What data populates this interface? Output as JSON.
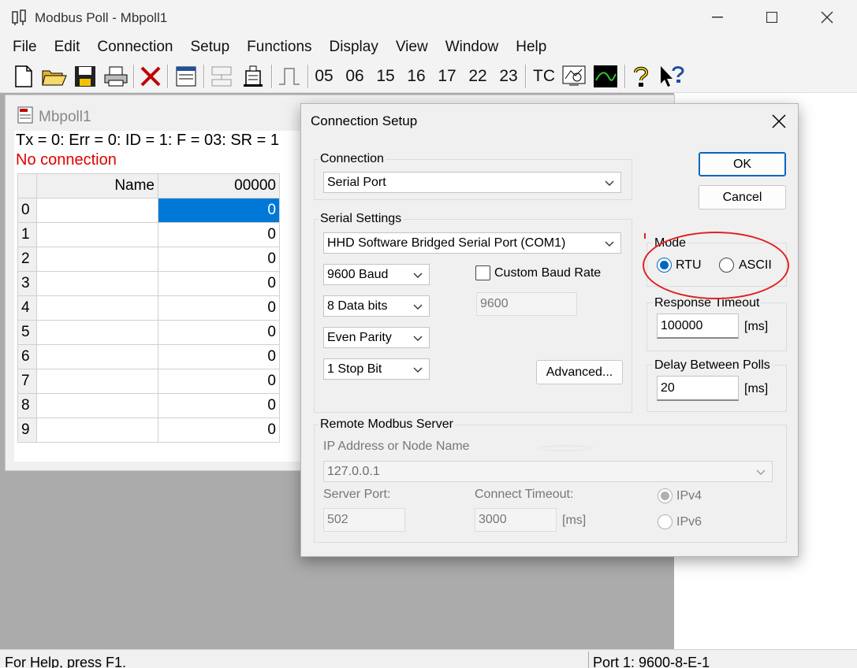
{
  "app": {
    "title": "Modbus Poll - Mbpoll1"
  },
  "window_controls": {
    "minimize": "—",
    "maximize": "☐",
    "close": "✕"
  },
  "menu": [
    "File",
    "Edit",
    "Connection",
    "Setup",
    "Functions",
    "Display",
    "View",
    "Window",
    "Help"
  ],
  "toolbar": {
    "function_codes": [
      "05",
      "06",
      "15",
      "16",
      "17",
      "22",
      "23"
    ],
    "tc": "TC"
  },
  "child": {
    "title": "Mbpoll1",
    "status_line": "Tx = 0: Err = 0: ID = 1: F = 03: SR = 1",
    "no_connection": "No connection",
    "header_name": "Name",
    "header_col": "00000",
    "rows": [
      {
        "n": "0",
        "v": "0"
      },
      {
        "n": "1",
        "v": "0"
      },
      {
        "n": "2",
        "v": "0"
      },
      {
        "n": "3",
        "v": "0"
      },
      {
        "n": "4",
        "v": "0"
      },
      {
        "n": "5",
        "v": "0"
      },
      {
        "n": "6",
        "v": "0"
      },
      {
        "n": "7",
        "v": "0"
      },
      {
        "n": "8",
        "v": "0"
      },
      {
        "n": "9",
        "v": "0"
      }
    ]
  },
  "dialog": {
    "title": "Connection Setup",
    "close": "✕",
    "connection_group": "Connection",
    "connection_value": "Serial Port",
    "serial_group": "Serial Settings",
    "port_value": "HHD Software Bridged Serial Port (COM1)",
    "baud_value": "9600 Baud",
    "databits_value": "8 Data bits",
    "parity_value": "Even Parity",
    "stopbit_value": "1 Stop Bit",
    "custom_baud_label": "Custom Baud Rate",
    "custom_baud_value": "9600",
    "advanced_button": "Advanced...",
    "ok_button": "OK",
    "cancel_button": "Cancel",
    "mode_group": "Mode",
    "mode_rtu": "RTU",
    "mode_ascii": "ASCII",
    "response_timeout_group": "Response Timeout",
    "response_timeout_value": "100000",
    "ms_unit": "[ms]",
    "delay_group": "Delay Between Polls",
    "delay_value": "20",
    "remote_group": "Remote Modbus Server",
    "ip_label": "IP Address or Node Name",
    "ip_value": "127.0.0.1",
    "server_port_label": "Server Port:",
    "server_port_value": "502",
    "connect_timeout_label": "Connect Timeout:",
    "connect_timeout_value": "3000",
    "ipv4": "IPv4",
    "ipv6": "IPv6"
  },
  "status": {
    "help": "For Help, press F1.",
    "port": "Port 1: 9600-8-E-1"
  },
  "colors": {
    "selection": "#0078d7",
    "annotation": "#e02020",
    "error_text": "#e00000"
  }
}
